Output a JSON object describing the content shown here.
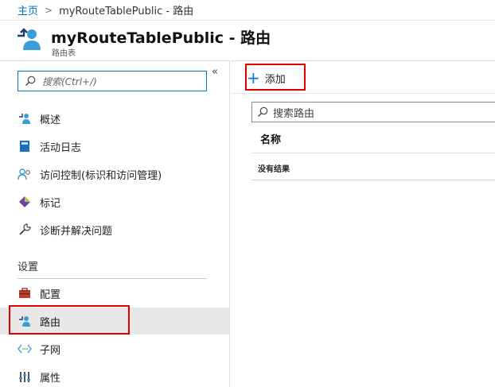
{
  "breadcrumb": {
    "home": "主页",
    "separator": ">",
    "current": "myRouteTablePublic - 路由"
  },
  "header": {
    "title": "myRouteTablePublic - 路由",
    "subtitle": "路由表",
    "icon": "route-table-icon"
  },
  "leftnav": {
    "collapse_glyph": "«",
    "search_placeholder": "搜索(Ctrl+/)",
    "items": [
      {
        "label": "概述",
        "icon": "overview-icon"
      },
      {
        "label": "活动日志",
        "icon": "activity-log-icon"
      },
      {
        "label": "访问控制(标识和访问管理)",
        "icon": "access-control-icon"
      },
      {
        "label": "标记",
        "icon": "tag-icon"
      },
      {
        "label": "诊断并解决问题",
        "icon": "wrench-icon"
      }
    ],
    "section_label": "设置",
    "settings_items": [
      {
        "label": "配置",
        "icon": "configuration-icon"
      },
      {
        "label": "路由",
        "icon": "routes-icon",
        "selected": true
      },
      {
        "label": "子网",
        "icon": "subnet-icon"
      },
      {
        "label": "属性",
        "icon": "properties-icon"
      }
    ]
  },
  "main": {
    "add_label": "添加",
    "search_placeholder": "搜索路由",
    "column_name": "名称",
    "no_results": "没有结果"
  },
  "colors": {
    "accent": "#0078d4",
    "link": "#0072c6",
    "highlight_box": "#e00000",
    "selected_bg": "#e8e8e8"
  }
}
